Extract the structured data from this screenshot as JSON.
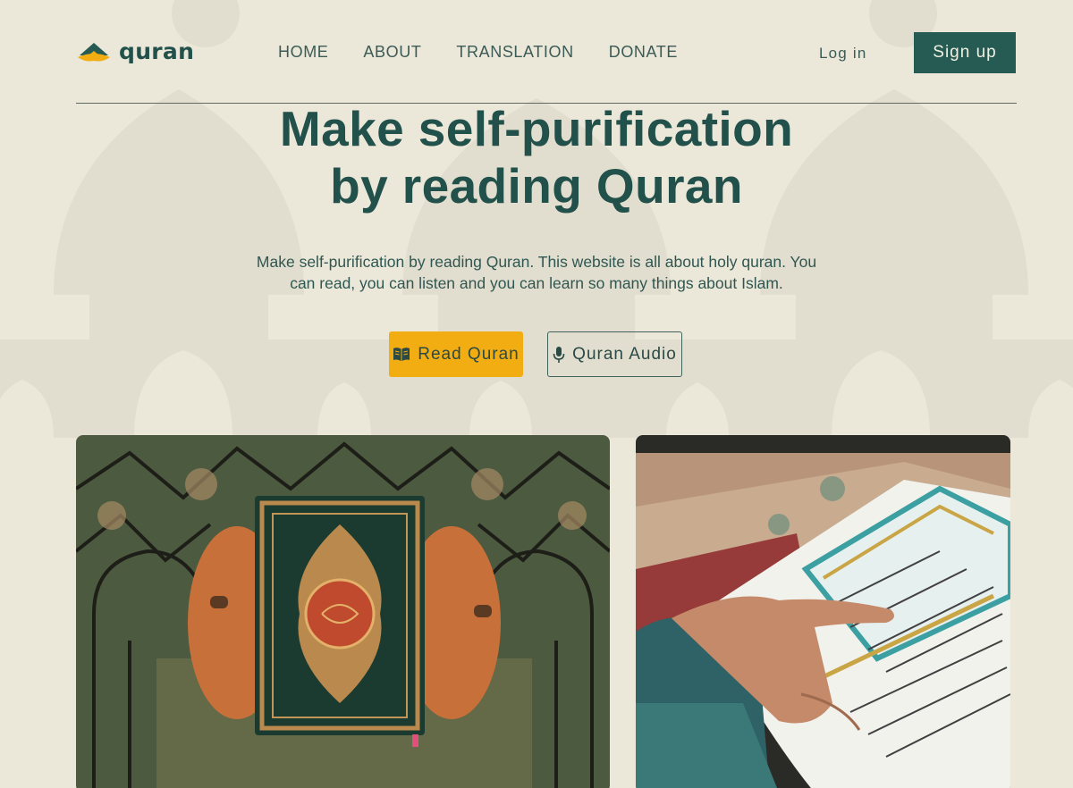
{
  "brand": {
    "name": "quran"
  },
  "nav": {
    "items": [
      {
        "label": "HOME"
      },
      {
        "label": "ABOUT"
      },
      {
        "label": "TRANSLATION"
      },
      {
        "label": "DONATE"
      }
    ],
    "login_label": "Log in",
    "signup_label": "Sign up"
  },
  "hero": {
    "title_line1": "Make self-purification",
    "title_line2": "by reading Quran",
    "description": "Make self-purification by reading Quran. This website is all about holy quran. You can read, you can listen and you can learn so many things about Islam.",
    "read_button": {
      "label": "Read Quran",
      "icon": "book-icon"
    },
    "audio_button": {
      "label": "Quran Audio",
      "icon": "microphone-icon"
    }
  },
  "images": [
    {
      "name": "quran-book-on-prayer-mat-photo"
    },
    {
      "name": "reading-quran-page-photo"
    }
  ],
  "colors": {
    "background": "#ebe7d9",
    "primary": "#255b52",
    "accent": "#f2ad12",
    "text": "#22504a"
  }
}
